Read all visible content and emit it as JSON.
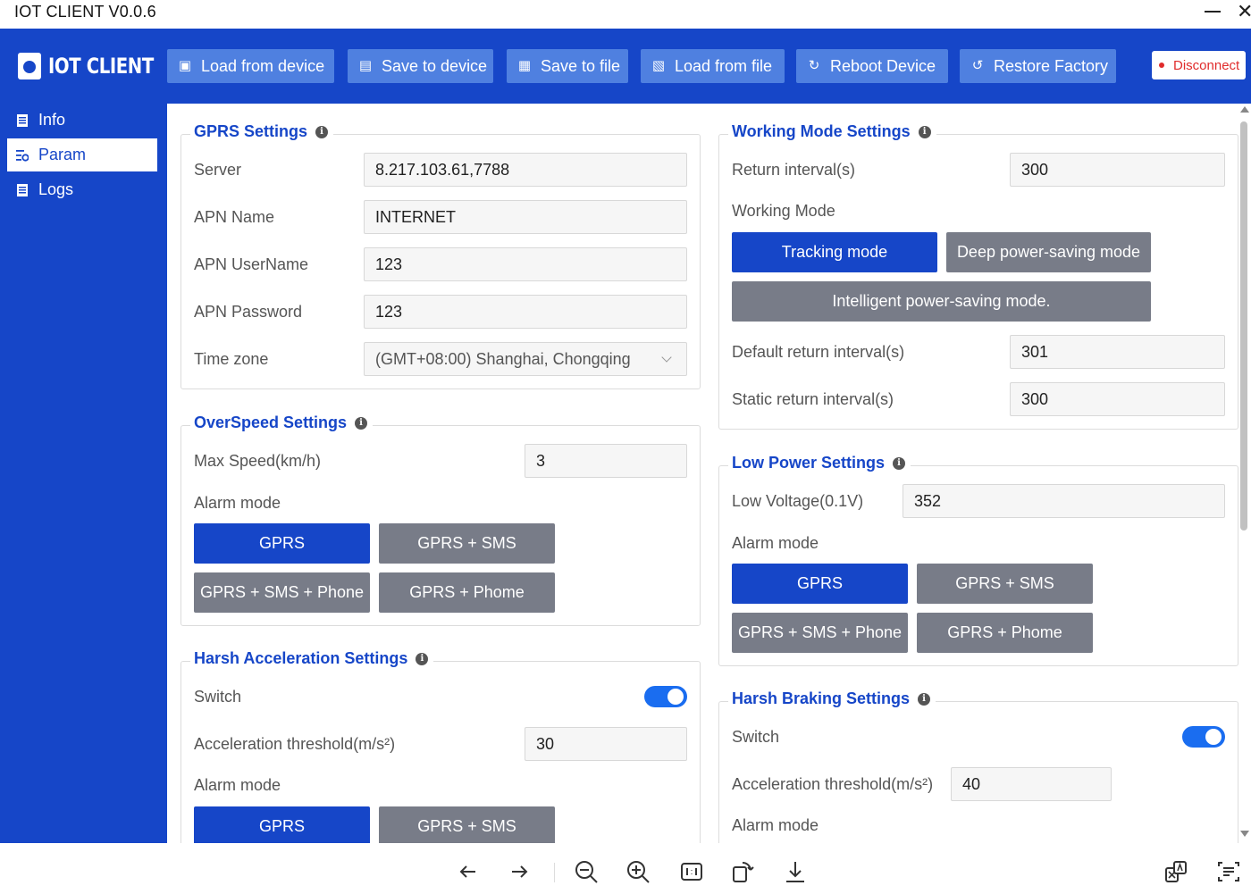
{
  "window": {
    "title": "IOT CLIENT V0.0.6",
    "close_glyph": "✕"
  },
  "app": {
    "logo_text": "IOT CLIENT"
  },
  "toolbar": {
    "load_device": "Load from device",
    "save_device": "Save to device",
    "save_file": "Save to file",
    "load_file": "Load from file",
    "reboot": "Reboot Device",
    "restore": "Restore Factory",
    "disconnect": "Disconnect"
  },
  "sidebar": {
    "items": [
      {
        "label": "Info",
        "icon": "doc-icon"
      },
      {
        "label": "Param",
        "icon": "settings-icon",
        "active": true
      },
      {
        "label": "Logs",
        "icon": "doc-icon"
      }
    ]
  },
  "gprs": {
    "title": "GPRS Settings",
    "server_label": "Server",
    "server_value": "8.217.103.61,7788",
    "apn_name_label": "APN Name",
    "apn_name_value": "INTERNET",
    "apn_user_label": "APN UserName",
    "apn_user_value": "123",
    "apn_pass_label": "APN Password",
    "apn_pass_value": "123",
    "timezone_label": "Time zone",
    "timezone_value": "(GMT+08:00) Shanghai, Chongqing"
  },
  "overspeed": {
    "title": "OverSpeed Settings",
    "max_speed_label": "Max Speed(km/h)",
    "max_speed_value": "3",
    "alarm_label": "Alarm mode",
    "modes": [
      "GPRS",
      "GPRS + SMS",
      "GPRS + SMS + Phone",
      "GPRS + Phome"
    ],
    "selected": "GPRS"
  },
  "harsh_accel": {
    "title": "Harsh Acceleration Settings",
    "switch_label": "Switch",
    "switch_on": true,
    "threshold_label": "Acceleration threshold(m/s²)",
    "threshold_value": "30",
    "alarm_label": "Alarm mode",
    "modes": [
      "GPRS",
      "GPRS + SMS"
    ],
    "selected": "GPRS"
  },
  "working_mode": {
    "title": "Working Mode Settings",
    "return_label": "Return interval(s)",
    "return_value": "300",
    "mode_label": "Working Mode",
    "modes": [
      "Tracking mode",
      "Deep power-saving mode",
      "Intelligent power-saving mode."
    ],
    "selected": "Tracking mode",
    "default_return_label": "Default return interval(s)",
    "default_return_value": "301",
    "static_return_label": "Static return interval(s)",
    "static_return_value": "300"
  },
  "low_power": {
    "title": "Low Power Settings",
    "voltage_label": "Low Voltage(0.1V)",
    "voltage_value": "352",
    "alarm_label": "Alarm mode",
    "modes": [
      "GPRS",
      "GPRS + SMS",
      "GPRS + SMS + Phone",
      "GPRS + Phome"
    ],
    "selected": "GPRS"
  },
  "harsh_braking": {
    "title": "Harsh Braking Settings",
    "switch_label": "Switch",
    "switch_on": true,
    "threshold_label": "Acceleration threshold(m/s²)",
    "threshold_value": "40",
    "alarm_label": "Alarm mode"
  },
  "colors": {
    "primary": "#1646c8",
    "button_light": "#4f80e0",
    "mode_inactive": "#787c88",
    "danger": "#e02b2b",
    "toggle": "#1a6df0"
  }
}
